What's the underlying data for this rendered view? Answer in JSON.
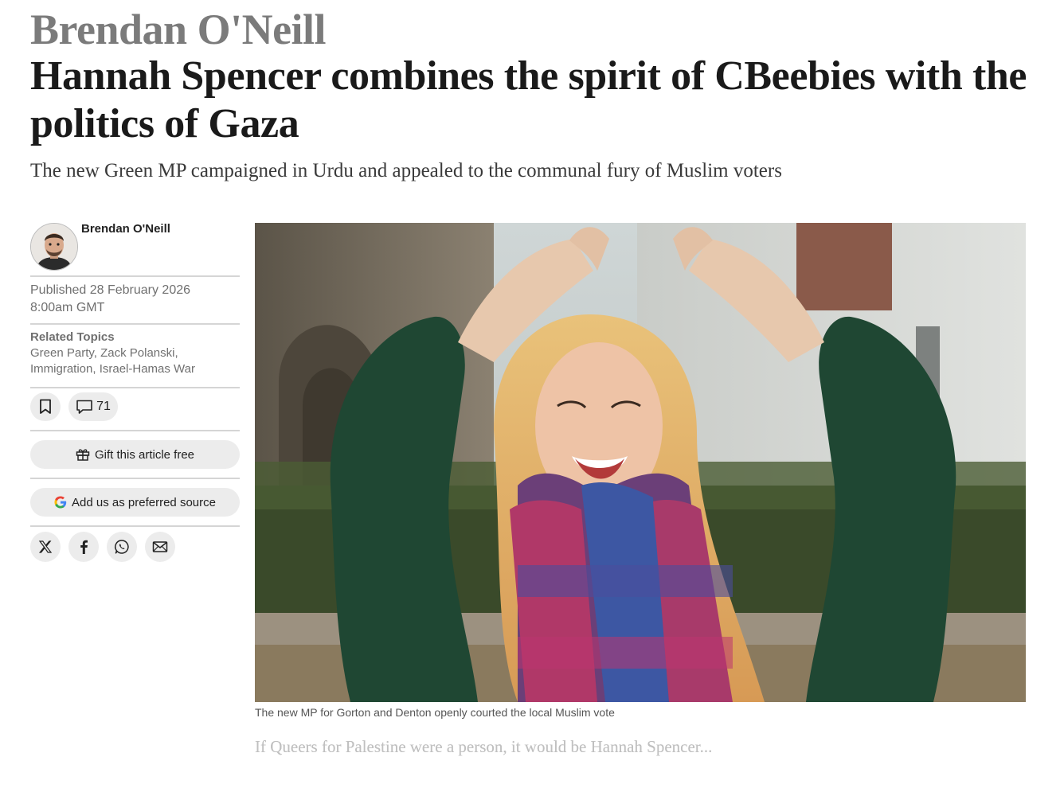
{
  "article": {
    "kicker": "Brendan O'Neill",
    "headline": "Hannah Spencer combines the spirit of CBeebies with the politics of Gaza",
    "standfirst": "The new Green MP campaigned in Urdu and appealed to the communal fury of Muslim voters"
  },
  "byline": {
    "author": "Brendan O'Neill",
    "published": "Published 28 February 2026",
    "time": "8:00am GMT"
  },
  "topics": {
    "title": "Related Topics",
    "list": "Green Party, Zack Polanski, Immigration, Israel-Hamas War"
  },
  "actions": {
    "comment_count": "71",
    "gift_label": "Gift this article free",
    "preferred_source_label": "Add us as preferred source"
  },
  "share": {
    "icons": [
      "x-icon",
      "facebook-icon",
      "whatsapp-icon",
      "email-icon"
    ]
  },
  "image": {
    "caption": "The new MP for Gorton and Denton openly courted the local Muslim vote"
  },
  "teaser": "If Queers for Palestine were a person, it would be Hannah Spencer..."
}
